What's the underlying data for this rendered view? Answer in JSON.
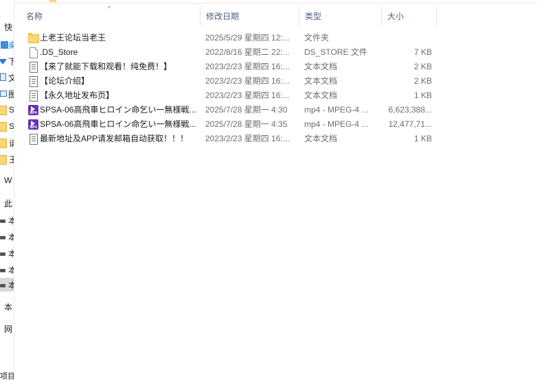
{
  "nav": {
    "items": [
      {
        "label": "快",
        "icon": "star-icon"
      },
      {
        "label": "桌",
        "icon": "desktop-icon"
      },
      {
        "label": "下",
        "icon": "download-arrow-icon"
      },
      {
        "label": "文",
        "icon": "document-icon"
      },
      {
        "label": "图",
        "icon": "picture-icon"
      },
      {
        "label": "S",
        "icon": "folder-icon"
      },
      {
        "label": "S",
        "icon": "folder-icon"
      },
      {
        "label": "请",
        "icon": "folder-icon"
      },
      {
        "label": "王",
        "icon": "folder-icon"
      },
      {
        "label": "W",
        "icon": "onedrive-icon"
      },
      {
        "label": "此",
        "icon": "this-pc-icon"
      },
      {
        "label": "本",
        "icon": "drive-icon"
      },
      {
        "label": "本",
        "icon": "drive-icon"
      },
      {
        "label": "本",
        "icon": "drive-icon"
      },
      {
        "label": "本",
        "icon": "drive-icon"
      },
      {
        "label": "本",
        "icon": "drive-icon"
      },
      {
        "label": "本",
        "icon": "drive-icon"
      },
      {
        "label": "网",
        "icon": "network-icon"
      },
      {
        "label": "项目",
        "icon": ""
      }
    ]
  },
  "header": {
    "name": "名称",
    "date": "修改日期",
    "type": "类型",
    "size": "大小",
    "sort_glyph": "^"
  },
  "files": [
    {
      "icon": "folder",
      "name": "上老王论坛当老王",
      "date": "2025/5/29 星期四 12:...",
      "type": "文件夹",
      "size": ""
    },
    {
      "icon": "file",
      "name": ".DS_Store",
      "date": "2022/8/16 星期二 22:...",
      "type": "DS_STORE 文件",
      "size": "7 KB"
    },
    {
      "icon": "text",
      "name": "【来了就能下载和观看！纯免费！】",
      "date": "2023/2/23 星期四 16:...",
      "type": "文本文档",
      "size": "2 KB"
    },
    {
      "icon": "text",
      "name": "【论坛介绍】",
      "date": "2023/2/23 星期四 16:...",
      "type": "文本文档",
      "size": "2 KB"
    },
    {
      "icon": "text",
      "name": "【永久地址发布页】",
      "date": "2023/2/23 星期四 16:...",
      "type": "文本文档",
      "size": "1 KB"
    },
    {
      "icon": "video",
      "name": "SPSA-06高飛車ヒロイン命乞い一無様戦...",
      "date": "2025/7/28 星期一 4:30",
      "type": "mp4 - MPEG-4 ...",
      "size": "6,623,388..."
    },
    {
      "icon": "video",
      "name": "SPSA-06高飛車ヒロイン命乞い一無様戦...",
      "date": "2025/7/28 星期一 4:35",
      "type": "mp4 - MPEG-4 ...",
      "size": "12,477,71..."
    },
    {
      "icon": "text",
      "name": "最新地址及APP请发邮箱自动获取！！！",
      "date": "2023/2/23 星期四 16:...",
      "type": "文本文档",
      "size": "1 KB"
    }
  ],
  "colors": {
    "header_text": "#4c607a",
    "muted_text": "#6d6d6d",
    "folder": "#f8d775",
    "video_icon": "#6a2fb5"
  }
}
